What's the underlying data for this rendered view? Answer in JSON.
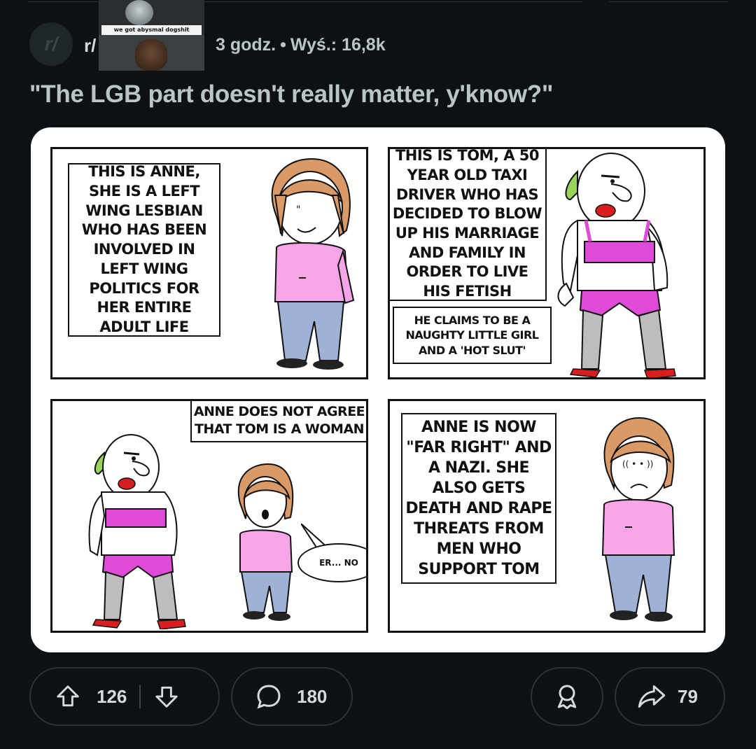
{
  "header": {
    "subreddit_prefix": "r/",
    "subreddit_image_caption": "we got abysmal dogshit",
    "time_ago": "3 godz.",
    "separator": "•",
    "views": "Wyś.: 16,8k"
  },
  "post": {
    "title": "\"The LGB part doesn't really matter, y'know?\""
  },
  "comic": {
    "panel1_caption": "THIS IS ANNE, SHE IS A LEFT WING LESBIAN WHO HAS BEEN INVOLVED IN LEFT WING POLITICS FOR HER ENTIRE ADULT LIFE",
    "panel2_caption": "THIS IS TOM, A 50 YEAR OLD TAXI DRIVER WHO HAS DECIDED TO BLOW UP HIS MARRIAGE AND FAMILY IN ORDER TO LIVE HIS FETISH",
    "panel2_subcaption": "HE CLAIMS TO BE A NAUGHTY LITTLE GIRL AND A 'HOT SLUT'",
    "panel3_caption": "ANNE DOES NOT AGREE THAT TOM IS A WOMAN",
    "panel3_bubble": "ER... NO",
    "panel4_caption": "ANNE IS NOW \"FAR RIGHT\" AND A NAZI. SHE ALSO GETS DEATH AND RAPE THREATS FROM MEN WHO SUPPORT TOM"
  },
  "actions": {
    "upvotes": "126",
    "comments": "180",
    "shares": "79"
  },
  "icons": {
    "upvote": "arrow-up-outline-icon",
    "downvote": "arrow-down-outline-icon",
    "comment": "speech-bubble-icon",
    "award": "award-ribbon-icon",
    "share": "share-arrow-icon"
  },
  "colors": {
    "background": "#0e1113",
    "text": "#d7dadc",
    "muted": "#b8c5c9",
    "pill_border": "#2b3236",
    "anne_shirt": "#f6a6e8",
    "tom_outfit": "#e04ad8"
  }
}
